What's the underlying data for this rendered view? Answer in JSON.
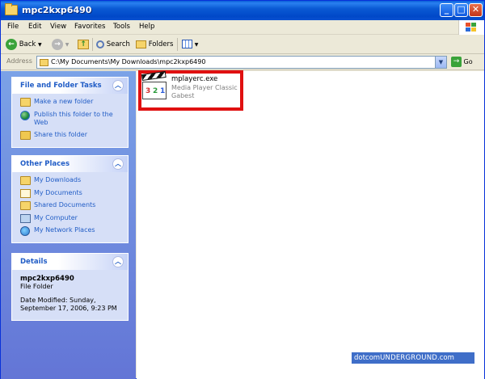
{
  "window": {
    "title": "mpc2kxp6490"
  },
  "menu": [
    "File",
    "Edit",
    "View",
    "Favorites",
    "Tools",
    "Help"
  ],
  "toolbar": {
    "back": "Back",
    "search": "Search",
    "folders": "Folders"
  },
  "address": {
    "label": "Address",
    "path": "C:\\My Documents\\My Downloads\\mpc2kxp6490",
    "go": "Go"
  },
  "tasks_panel": {
    "title": "File and Folder Tasks",
    "items": [
      {
        "label": "Make a new folder",
        "icon": "new-folder-icon"
      },
      {
        "label": "Publish this folder to the Web",
        "icon": "globe-icon"
      },
      {
        "label": "Share this folder",
        "icon": "share-folder-icon"
      }
    ]
  },
  "places_panel": {
    "title": "Other Places",
    "items": [
      {
        "label": "My Downloads",
        "icon": "folder-icon"
      },
      {
        "label": "My Documents",
        "icon": "documents-icon"
      },
      {
        "label": "Shared Documents",
        "icon": "folder-icon"
      },
      {
        "label": "My Computer",
        "icon": "computer-icon"
      },
      {
        "label": "My Network Places",
        "icon": "network-icon"
      }
    ]
  },
  "details_panel": {
    "title": "Details",
    "name": "mpc2kxp6490",
    "type": "File Folder",
    "modified_line1": "Date Modified: Sunday,",
    "modified_line2": "September 17, 2006, 9:23 PM"
  },
  "file": {
    "name": "mplayerc.exe",
    "description": "Media Player Classic",
    "company": "Gabest",
    "icon": "clapperboard-icon",
    "icon_digits": [
      "3",
      "2",
      "1"
    ]
  },
  "watermark": {
    "part1": "dotcom",
    "part2": "UNDERGROUND",
    "part3": ".com"
  },
  "colors": {
    "titlebar": "#0a5ad4",
    "panel_link": "#215dc6",
    "highlight": "#e01010",
    "leftpane": "#7ba2e7"
  }
}
